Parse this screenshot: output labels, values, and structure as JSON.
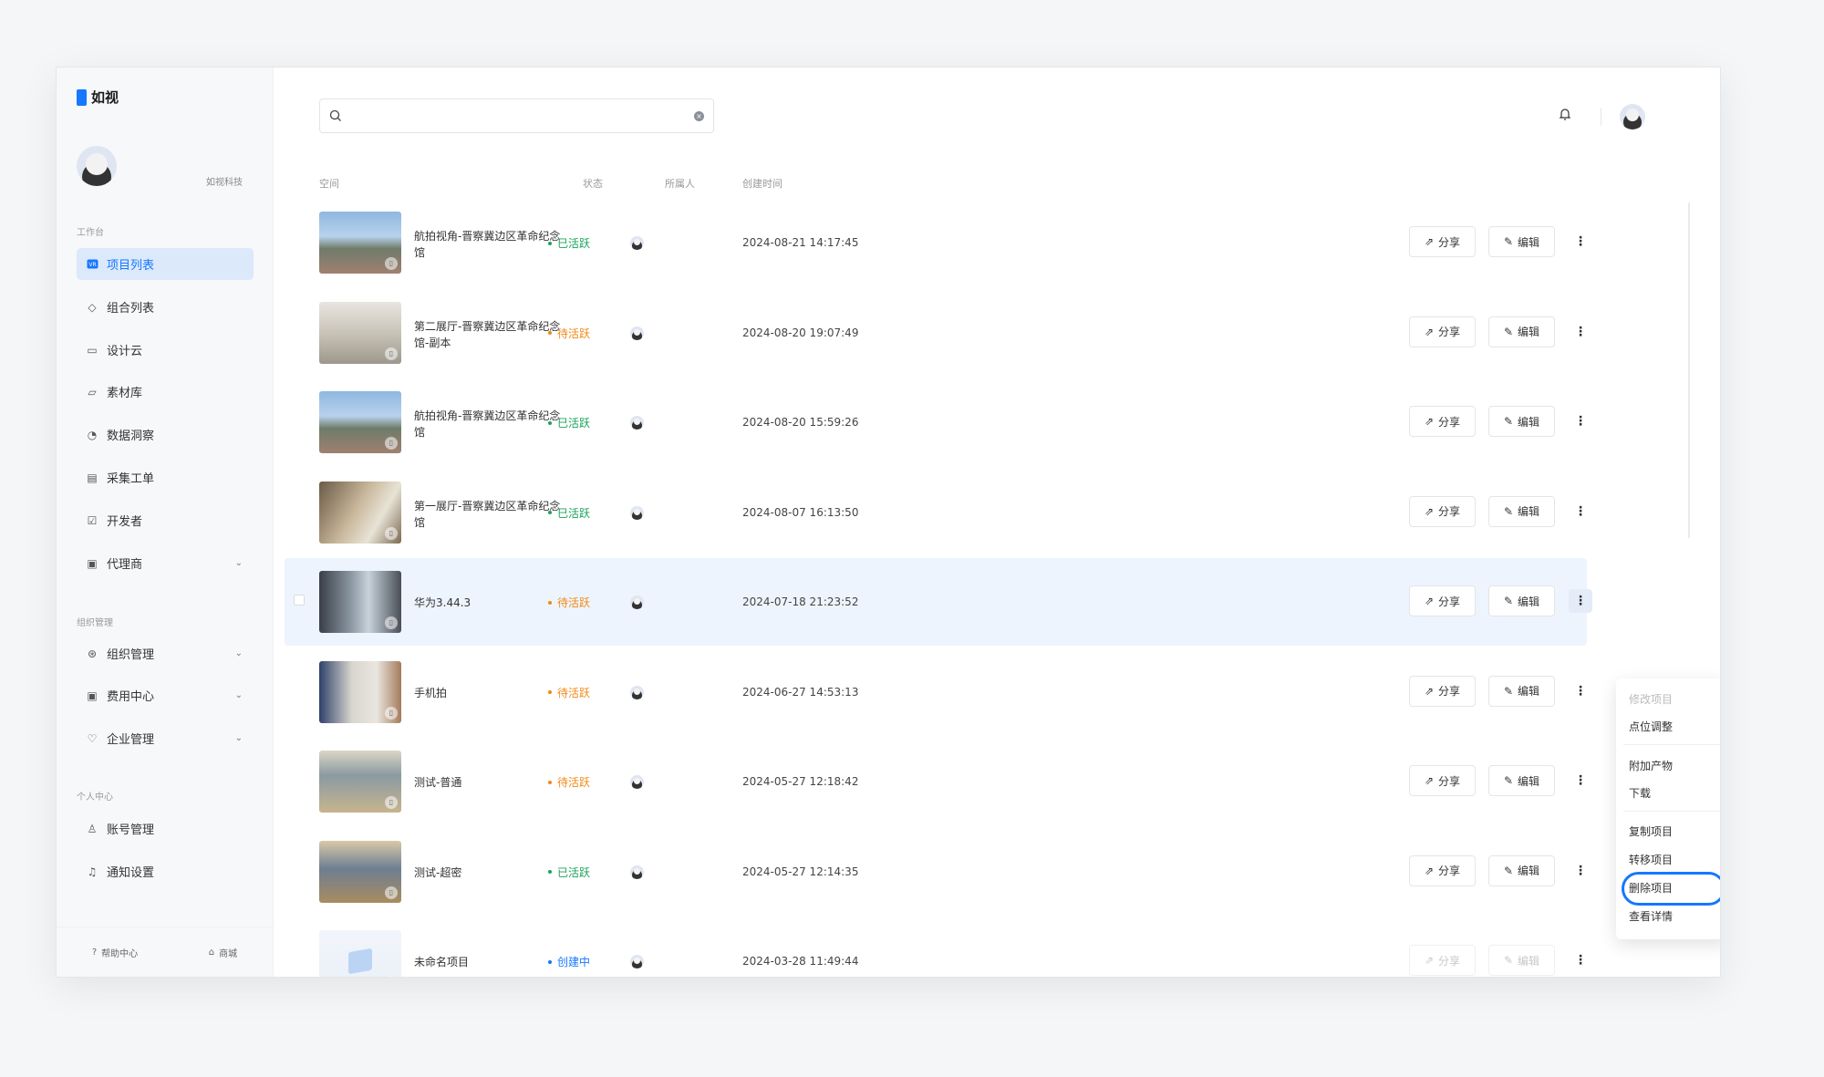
{
  "app": {
    "name": "如视"
  },
  "profile": {
    "name": "如视科技"
  },
  "sidebar": {
    "sections": [
      "工作台",
      "组织管理",
      "个人中心"
    ],
    "items": [
      {
        "label": "项目列表",
        "icon": "vr-icon",
        "active": true
      },
      {
        "label": "组合列表",
        "icon": "layers-icon"
      },
      {
        "label": "设计云",
        "icon": "monitor-icon"
      },
      {
        "label": "素材库",
        "icon": "folder-icon"
      },
      {
        "label": "数据洞察",
        "icon": "chart-icon"
      },
      {
        "label": "采集工单",
        "icon": "clipboard-icon"
      },
      {
        "label": "开发者",
        "icon": "code-icon"
      },
      {
        "label": "代理商",
        "icon": "briefcase-icon"
      },
      {
        "label": "组织管理",
        "icon": "org-icon"
      },
      {
        "label": "费用中心",
        "icon": "wallet-icon"
      },
      {
        "label": "企业管理",
        "icon": "shield-icon"
      },
      {
        "label": "账号管理",
        "icon": "user-icon"
      },
      {
        "label": "通知设置",
        "icon": "bell-icon"
      }
    ],
    "footer": {
      "help": "帮助中心",
      "shop": "商城"
    }
  },
  "search": {
    "placeholder": "",
    "value": ""
  },
  "columns": {
    "space": "空间",
    "status": "状态",
    "owner": "所属人",
    "created": "创建时间"
  },
  "actions": {
    "share": "分享",
    "edit": "编辑"
  },
  "rows": [
    {
      "name": "航拍视角-晋察冀边区革命纪念馆",
      "status": "已活跃",
      "time": "2024-08-21 14:17:45"
    },
    {
      "name": "第二展厅-晋察冀边区革命纪念馆-副本",
      "status": "待活跃",
      "time": "2024-08-20 19:07:49"
    },
    {
      "name": "航拍视角-晋察冀边区革命纪念馆",
      "status": "已活跃",
      "time": "2024-08-20 15:59:26"
    },
    {
      "name": "第一展厅-晋察冀边区革命纪念馆",
      "status": "已活跃",
      "time": "2024-08-07 16:13:50"
    },
    {
      "name": "华为3.44.3",
      "status": "待活跃",
      "time": "2024-07-18 21:23:52"
    },
    {
      "name": "手机拍",
      "status": "待活跃",
      "time": "2024-06-27 14:53:13"
    },
    {
      "name": "测试-普通",
      "status": "待活跃",
      "time": "2024-05-27 12:18:42"
    },
    {
      "name": "测试-超密",
      "status": "已活跃",
      "time": "2024-05-27 12:14:35"
    },
    {
      "name": "未命名项目",
      "status": "创建中",
      "time": "2024-03-28 11:49:44"
    }
  ],
  "status_colors": {
    "已活跃": "#1aa35a",
    "待活跃": "#f08a16",
    "创建中": "#1677ff"
  },
  "menu": {
    "items": [
      "修改项目",
      "点位调整",
      "附加产物",
      "下载",
      "复制项目",
      "转移项目",
      "删除项目",
      "查看详情"
    ]
  }
}
